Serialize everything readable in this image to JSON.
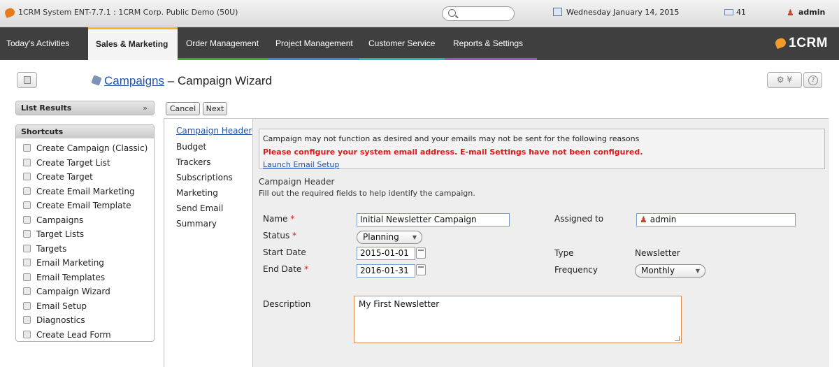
{
  "topbar": {
    "title": "1CRM System ENT-7.7.1 : 1CRM Corp. Public Demo (50U)",
    "date": "Wednesday January 14, 2015",
    "mail_count": "41",
    "user": "admin"
  },
  "nav": {
    "tabs": [
      {
        "label": "Today's Activities"
      },
      {
        "label": "Sales & Marketing"
      },
      {
        "label": "Order Management"
      },
      {
        "label": "Project Management"
      },
      {
        "label": "Customer Service"
      },
      {
        "label": "Reports & Settings"
      }
    ],
    "brand": "1CRM",
    "accent_colors": [
      "#f5b21b",
      "#3eaa38",
      "#2f8fd6",
      "#29b3b3",
      "#9b59b6"
    ]
  },
  "header": {
    "module_link": "Campaigns",
    "separator": "–",
    "page_title": "Campaign Wizard",
    "gear_label": "⚙ ¥"
  },
  "sidebar": {
    "list_results": "List Results",
    "shortcuts_title": "Shortcuts",
    "shortcuts": [
      {
        "label": "Create Campaign (Classic)"
      },
      {
        "label": "Create Target List"
      },
      {
        "label": "Create Target"
      },
      {
        "label": "Create Email Marketing"
      },
      {
        "label": "Create Email Template"
      },
      {
        "label": "Campaigns"
      },
      {
        "label": "Target Lists"
      },
      {
        "label": "Targets"
      },
      {
        "label": "Email Marketing"
      },
      {
        "label": "Email Templates"
      },
      {
        "label": "Campaign Wizard"
      },
      {
        "label": "Email Setup"
      },
      {
        "label": "Diagnostics"
      },
      {
        "label": "Create Lead Form"
      }
    ]
  },
  "wizard": {
    "cancel_label": "Cancel",
    "next_label": "Next",
    "steps": [
      {
        "label": "Campaign Header"
      },
      {
        "label": "Budget"
      },
      {
        "label": "Trackers"
      },
      {
        "label": "Subscriptions"
      },
      {
        "label": "Marketing"
      },
      {
        "label": "Send Email"
      },
      {
        "label": "Summary"
      }
    ],
    "warning": {
      "line1": "Campaign may not function as desired and your emails may not be sent for the following reasons",
      "line2": "Please configure your system email address. E-mail Settings have not been configured.",
      "link": "Launch Email Setup"
    },
    "section_title": "Campaign Header",
    "section_sub": "Fill out the required fields to help identify the campaign.",
    "fields": {
      "name_label": "Name",
      "name_value": "Initial Newsletter Campaign",
      "status_label": "Status",
      "status_value": "Planning",
      "start_label": "Start Date",
      "start_value": "2015-01-01",
      "end_label": "End Date",
      "end_value": "2016-01-31",
      "assigned_label": "Assigned to",
      "assigned_value": "admin",
      "type_label": "Type",
      "type_value": "Newsletter",
      "frequency_label": "Frequency",
      "frequency_value": "Monthly",
      "description_label": "Description",
      "description_value": "My First Newsletter",
      "required_mark": "*"
    }
  }
}
